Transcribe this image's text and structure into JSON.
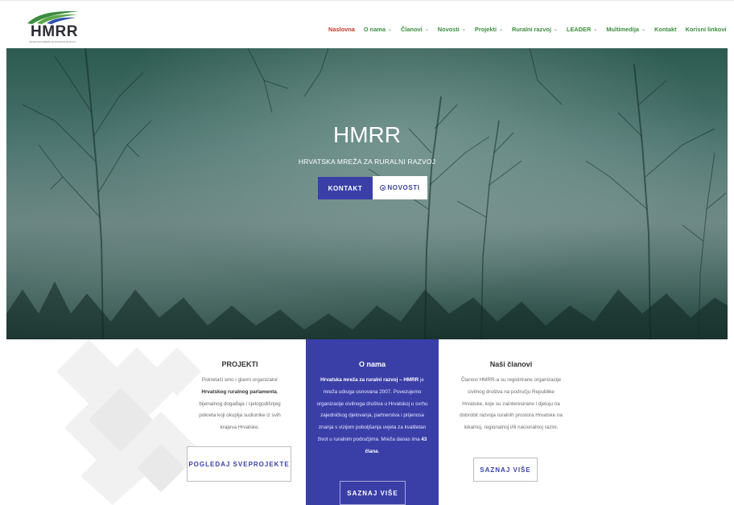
{
  "brand": {
    "logo_text": "HMRR",
    "logo_subtitle": "HRVATSKA MREŽA ZA RURALNI RAZVOJ",
    "logo_colors": [
      "#3b8d3e",
      "#2b2b33",
      "#2f4fb0"
    ]
  },
  "nav": {
    "items": [
      {
        "label": "Naslovna",
        "dropdown": false,
        "active": true
      },
      {
        "label": "O nama",
        "dropdown": true
      },
      {
        "label": "Članovi",
        "dropdown": true
      },
      {
        "label": "Novosti",
        "dropdown": true
      },
      {
        "label": "Projekti",
        "dropdown": true
      },
      {
        "label": "Ruralni razvoj",
        "dropdown": true
      },
      {
        "label": "LEADER",
        "dropdown": true
      },
      {
        "label": "Multimedija",
        "dropdown": true
      },
      {
        "label": "Kontakt",
        "dropdown": false
      },
      {
        "label": "Korisni linkovi",
        "dropdown": false
      }
    ],
    "chevron_glyph": "⌄",
    "language_flag": "croatian-flag-icon",
    "active_color": "#c0392b",
    "link_color": "#3b8d3e"
  },
  "hero": {
    "title": "HMRR",
    "subtitle": "HRVATSKA MREŽA ZA RURALNI RAZVOJ",
    "button_primary": "KONTAKT",
    "button_secondary": "NOVOSTI"
  },
  "sections": {
    "projekti": {
      "title": "PROJEKTI",
      "text_parts": [
        {
          "t": "Pokretači smo i glavni organizator ",
          "b": false
        },
        {
          "t": "Hrvatskog ruralnog parlamenta",
          "b": true
        },
        {
          "t": ", bijenalnog događaja i cjelogodišnjeg pokreta koji okuplja sudionike iz svih krajeva Hrvatske.",
          "b": false
        }
      ],
      "button_line1": "POGLEDAJ SVE",
      "button_line2": "PROJEKTE"
    },
    "o_nama": {
      "title": "O nama",
      "text_parts": [
        {
          "t": "Hrvatska mreža za ruralni razvoj – HMRR",
          "b": true
        },
        {
          "t": " je mreža udruga osnovana 2007. Povezujemo organizacije civilnoga društva u Hrvatskoj u svrhu zajedničkog djelovanja, partnerstva i prijenosa znanja s vizijom poboljšanja uvjeta za kvalitetan život u ruralnim područjima. Mreža danas ima ",
          "b": false
        },
        {
          "t": "43 člana",
          "b": true
        },
        {
          "t": ".",
          "b": false
        }
      ],
      "button": "SAZNAJ VIŠE"
    },
    "clanovi": {
      "title": "Naši članovi",
      "text_parts": [
        {
          "t": "Članovi HMRR-a su registrirane organizacije civilnog društva na području Republike Hrvatske, koje su zainteresirane i djeluju na dobrobit razvoja ruralnih prostora Hrvatske na lokalnoj, regionalnoj i/ili nacionalnoj razini.",
          "b": false
        }
      ],
      "button": "SAZNAJ VIŠE"
    }
  },
  "colors": {
    "accent": "#3a3fa8",
    "hero_tint": "#2c5a50"
  }
}
